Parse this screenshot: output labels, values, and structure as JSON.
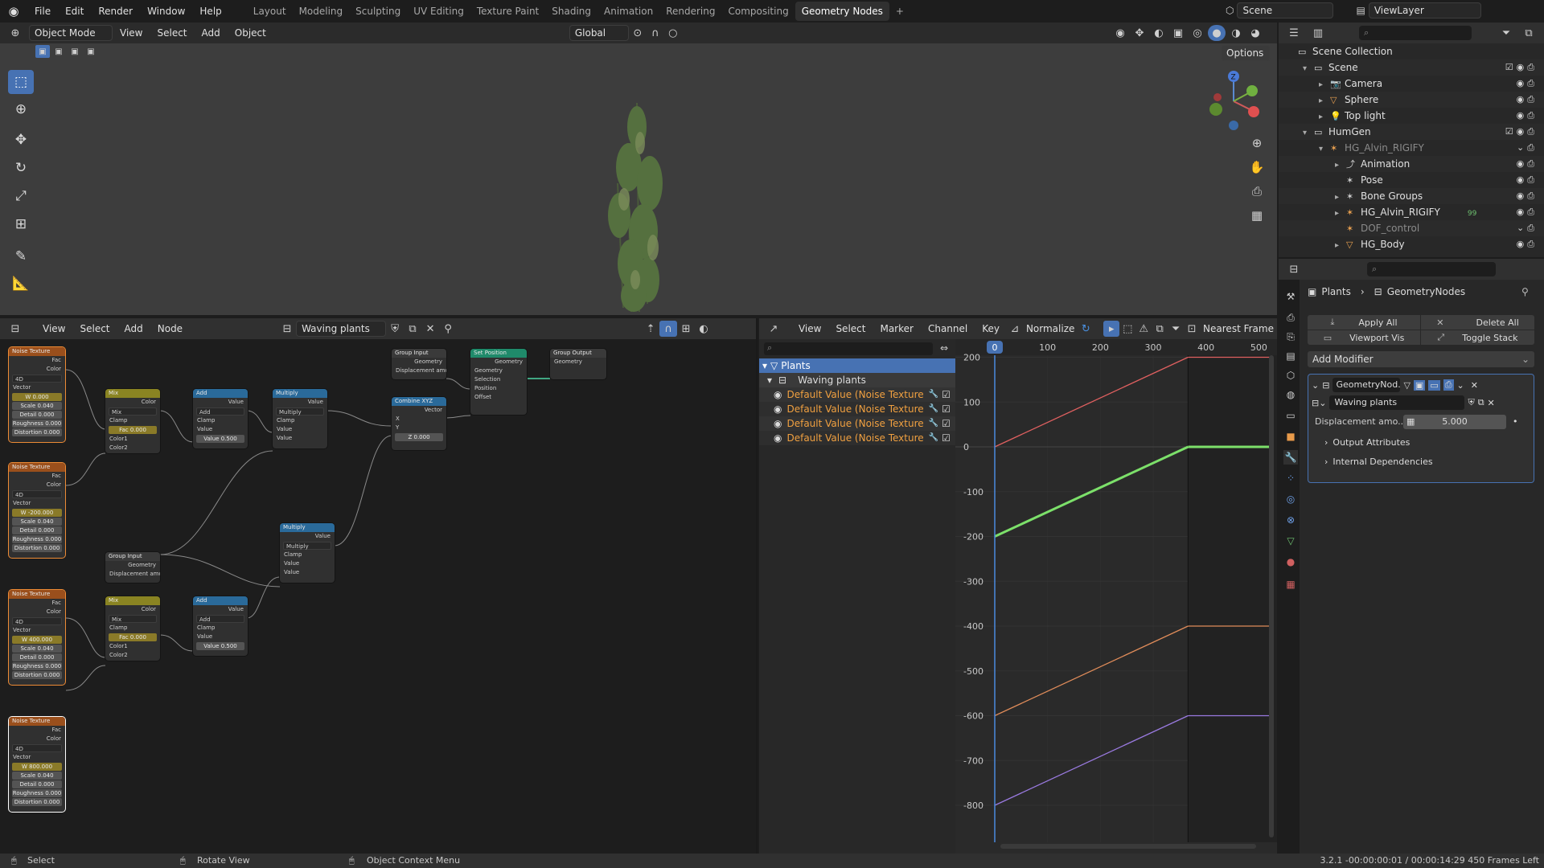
{
  "menu": {
    "items": [
      "File",
      "Edit",
      "Render",
      "Window",
      "Help"
    ],
    "workspaces": [
      "Layout",
      "Modeling",
      "Sculpting",
      "UV Editing",
      "Texture Paint",
      "Shading",
      "Animation",
      "Rendering",
      "Compositing",
      "Geometry Nodes"
    ],
    "active_workspace": "Geometry Nodes",
    "add_tab": "+",
    "scene": "Scene",
    "view_layer": "ViewLayer"
  },
  "viewport": {
    "mode": "Object Mode",
    "menus": [
      "View",
      "Select",
      "Add",
      "Object"
    ],
    "orientation": "Global",
    "options": "Options",
    "gizmo_z": "Z"
  },
  "node_editor": {
    "menus": [
      "View",
      "Select",
      "Add",
      "Node"
    ],
    "tree_name": "Waving plants",
    "nodes": {
      "noise_title": "Noise Texture",
      "fac": "Fac",
      "color": "Color",
      "dim": "4D",
      "vector": "Vector",
      "w_label": "W",
      "w_values": [
        "0.000",
        "-200.000",
        "400.000",
        "800.000"
      ],
      "scale": "Scale",
      "scale_val": "0.040",
      "detail": "Detail",
      "detail_val": "0.000",
      "roughness": "Roughness",
      "roughness_val": "0.000",
      "distortion": "Distortion",
      "distortion_val": "0.000",
      "mix": "Mix",
      "clamp": "Clamp",
      "fac_val": "0.000",
      "color1": "Color1",
      "color2": "Color2",
      "add": "Add",
      "value": "Value",
      "value_val": "0.500",
      "multiply": "Multiply",
      "group_input": "Group Input",
      "group_output": "Group Output",
      "geometry": "Geometry",
      "displacement": "Displacement amount",
      "combine_xyz": "Combine XYZ",
      "x": "X",
      "y": "Y",
      "z": "Z",
      "z_val": "0.000",
      "set_position": "Set Position",
      "selection": "Selection",
      "position": "Position",
      "offset": "Offset"
    }
  },
  "graph_editor": {
    "menus": [
      "View",
      "Select",
      "Marker",
      "Channel",
      "Key"
    ],
    "normalize": "Normalize",
    "interp": "Nearest Frame",
    "frame_labels": [
      "0",
      "100",
      "200",
      "300",
      "400",
      "500"
    ],
    "value_labels": [
      "200",
      "100",
      "0",
      "-100",
      "-200",
      "-300",
      "-400",
      "-500",
      "-600",
      "-700",
      "-800"
    ],
    "channels": {
      "group": "Plants",
      "object": "Waving plants",
      "fcurve": "Default Value (Noise Texture"
    },
    "curves": [
      {
        "color": "#e06060",
        "start": 0,
        "end": 200
      },
      {
        "color": "#7ce06a",
        "start": -200,
        "end": 0
      },
      {
        "color": "#e08c5a",
        "start": -600,
        "end": -400
      },
      {
        "color": "#9a7ae0",
        "start": -800,
        "end": -600
      }
    ],
    "current_frame": 0
  },
  "outliner": {
    "rows": [
      {
        "label": "Scene Collection",
        "indent": 0,
        "icon": "collection"
      },
      {
        "label": "Scene",
        "indent": 1,
        "icon": "collection"
      },
      {
        "label": "Camera",
        "indent": 2,
        "icon": "camera"
      },
      {
        "label": "Sphere",
        "indent": 2,
        "icon": "mesh"
      },
      {
        "label": "Top light",
        "indent": 2,
        "icon": "light"
      },
      {
        "label": "HumGen",
        "indent": 1,
        "icon": "collection"
      },
      {
        "label": "HG_Alvin_RIGIFY",
        "indent": 2,
        "icon": "armature"
      },
      {
        "label": "Animation",
        "indent": 3,
        "icon": "action"
      },
      {
        "label": "Pose",
        "indent": 3,
        "icon": "pose"
      },
      {
        "label": "Bone Groups",
        "indent": 3,
        "icon": "bones"
      },
      {
        "label": "HG_Alvin_RIGIFY",
        "indent": 3,
        "icon": "armature"
      },
      {
        "label": "DOF_control",
        "indent": 3,
        "icon": "armature"
      },
      {
        "label": "HG_Body",
        "indent": 3,
        "icon": "mesh"
      }
    ],
    "badge_99": "99"
  },
  "properties": {
    "breadcrumb_obj": "Plants",
    "breadcrumb_mod": "GeometryNodes",
    "apply_all": "Apply All",
    "delete_all": "Delete All",
    "viewport_vis": "Viewport Vis",
    "toggle_stack": "Toggle Stack",
    "add_modifier": "Add Modifier",
    "modifier_name": "GeometryNod...",
    "tree": "Waving plants",
    "disp_label": "Displacement amo...",
    "disp_value": "5.000",
    "output_attributes": "Output Attributes",
    "internal_dependencies": "Internal Dependencies"
  },
  "statusbar": {
    "select": "Select",
    "rotate": "Rotate View",
    "context": "Object Context Menu",
    "info": "3.2.1  -00:00:00:01 / 00:00:14:29  450 Frames Left"
  }
}
